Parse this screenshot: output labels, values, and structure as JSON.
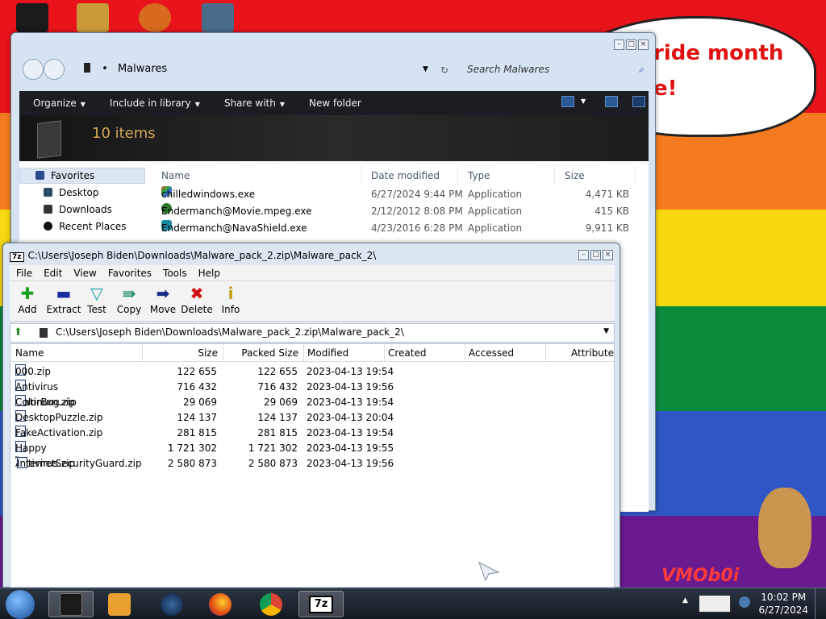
{
  "desktop": {
    "banner_text": "ride month\ne!",
    "logo_text": "VMOb0i"
  },
  "explorer": {
    "path": "Malwares",
    "search_placeholder": "Search Malwares",
    "toolbar": {
      "organize": "Organize",
      "include": "Include in library",
      "share": "Share with",
      "new_folder": "New folder"
    },
    "item_count": "10 items",
    "nav": {
      "favorites": "Favorites",
      "desktop": "Desktop",
      "downloads": "Downloads",
      "recent": "Recent Places"
    },
    "columns": {
      "name": "Name",
      "date": "Date modified",
      "type": "Type",
      "size": "Size"
    },
    "files": [
      {
        "name": "chilledwindows.exe",
        "date": "6/27/2024 9:44 PM",
        "type": "Application",
        "size": "4,471 KB"
      },
      {
        "name": "Endermanch@Movie.mpeg.exe",
        "date": "2/12/2012 8:08 PM",
        "type": "Application",
        "size": "415 KB"
      },
      {
        "name": "Endermanch@NavaShield.exe",
        "date": "4/23/2016 6:28 PM",
        "type": "Application",
        "size": "9,911 KB"
      }
    ]
  },
  "zip": {
    "title": "C:\\Users\\Joseph Biden\\Downloads\\Malware_pack_2.zip\\Malware_pack_2\\",
    "logo": "7z",
    "menu": {
      "file": "File",
      "edit": "Edit",
      "view": "View",
      "favorites": "Favorites",
      "tools": "Tools",
      "help": "Help"
    },
    "tools": {
      "add": "Add",
      "extract": "Extract",
      "test": "Test",
      "copy": "Copy",
      "move": "Move",
      "delete": "Delete",
      "info": "Info"
    },
    "path": "C:\\Users\\Joseph Biden\\Downloads\\Malware_pack_2.zip\\Malware_pack_2\\",
    "columns": {
      "name": "Name",
      "size": "Size",
      "packed": "Packed Size",
      "modified": "Modified",
      "created": "Created",
      "accessed": "Accessed",
      "attributes": "Attribute"
    },
    "files": [
      {
        "name": "000.zip",
        "size": "122 655",
        "packed": "122 655",
        "modified": "2023-04-13 19:54"
      },
      {
        "name": "Antivirus Platinum.zip",
        "size": "716 432",
        "packed": "716 432",
        "modified": "2023-04-13 19:56"
      },
      {
        "name": "ColorBug.zip",
        "size": "29 069",
        "packed": "29 069",
        "modified": "2023-04-13 19:54"
      },
      {
        "name": "DesktopPuzzle.zip",
        "size": "124 137",
        "packed": "124 137",
        "modified": "2023-04-13 20:04"
      },
      {
        "name": "FakeActivation.zip",
        "size": "281 815",
        "packed": "281 815",
        "modified": "2023-04-13 19:54"
      },
      {
        "name": "Happy Antivirus.zip",
        "size": "1 721 302",
        "packed": "1 721 302",
        "modified": "2023-04-13 19:55"
      },
      {
        "name": "InternetSecurityGuard.zip",
        "size": "2 580 873",
        "packed": "2 580 873",
        "modified": "2023-04-13 19:56"
      }
    ]
  },
  "taskbar": {
    "time": "10:02 PM",
    "date": "6/27/2024",
    "zip_label": "7z"
  },
  "colors": {
    "explorer_toolbar": "#1b1d22",
    "count_text": "#d2a85a"
  }
}
